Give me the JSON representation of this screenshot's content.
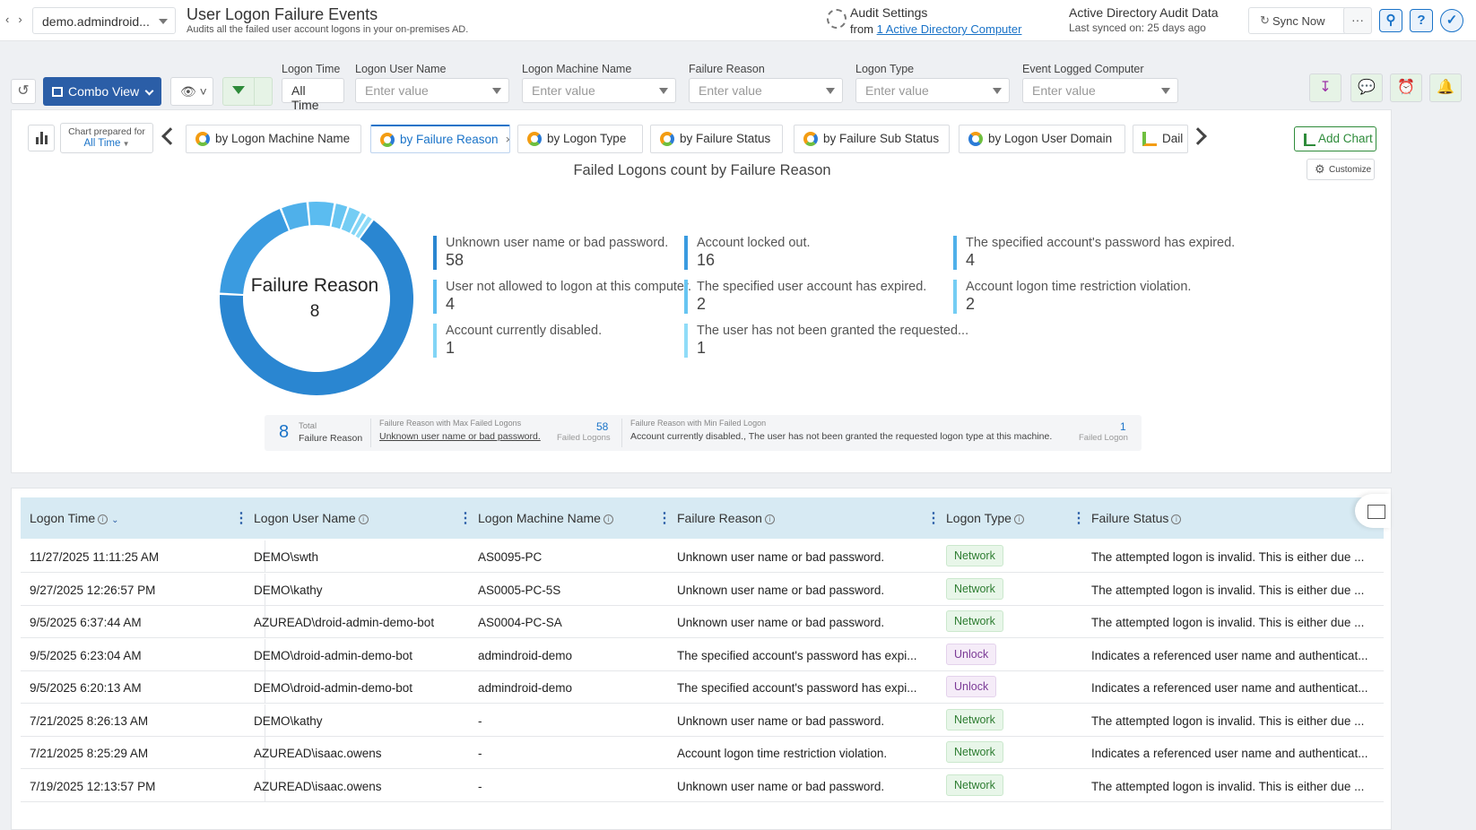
{
  "topbar": {
    "tenant": "demo.admindroid...",
    "title": "User Logon Failure Events",
    "subtitle": "Audits all the failed user account logons in your on-premises AD.",
    "audit_settings": "Audit Settings",
    "audit_from": "from",
    "audit_link": "1 Active Directory Computer",
    "ad_title": "Active Directory Audit Data",
    "last_synced_label": "Last synced on:",
    "last_synced_value": "25 days ago",
    "sync_now": "Sync Now",
    "more": "···"
  },
  "filters": {
    "combo_view": "Combo View",
    "logon_time_label": "Logon Time",
    "logon_time_value": "All Time",
    "user_label": "Logon User Name",
    "machine_label": "Logon Machine Name",
    "reason_label": "Failure Reason",
    "type_label": "Logon Type",
    "computer_label": "Event Logged Computer",
    "placeholder": "Enter value"
  },
  "chart_panel": {
    "prepared_for": "Chart prepared for",
    "prepared_value": "All Time",
    "tabs": [
      "by Logon Machine Name",
      "by Failure Reason",
      "by Logon Type",
      "by Failure Status",
      "by Failure Sub Status",
      "by Logon User Domain",
      "Dail"
    ],
    "add_chart": "Add Chart",
    "customize": "Customize",
    "center_label": "Failure Reason",
    "center_value": "8"
  },
  "chart_data": {
    "type": "pie",
    "title": "Failed Logons count by Failure Reason",
    "categories": [
      "Unknown user name or bad password.",
      "Account locked out.",
      "The specified account's password has expired.",
      "User not allowed to logon at this computer.",
      "The specified user account has expired.",
      "Account logon time restriction violation.",
      "Account currently disabled.",
      "The user has not been granted the requested..."
    ],
    "values": [
      58,
      16,
      4,
      4,
      2,
      2,
      1,
      1
    ],
    "colors": [
      "#2a86d1",
      "#3a9be0",
      "#4fb0ea",
      "#5bbcf0",
      "#67c5f2",
      "#74cdf4",
      "#82d5f6",
      "#90dcf8"
    ]
  },
  "summary": {
    "total_num": "8",
    "total_label": "Total",
    "total_sub": "Failure Reason",
    "max_head": "Failure Reason with Max Failed Logons",
    "max_link": "Unknown user name or bad password.",
    "max_num": "58",
    "max_sub": "Failed Logons",
    "min_head": "Failure Reason with Min Failed Logon",
    "min_text": "Account currently disabled., The user has not been granted the requested logon type at this machine.",
    "min_num": "1",
    "min_sub": "Failed Logon"
  },
  "table": {
    "headers": [
      "Logon Time",
      "Logon User Name",
      "Logon Machine Name",
      "Failure Reason",
      "Logon Type",
      "Failure Status"
    ],
    "rows": [
      [
        "11/27/2025 11:11:25 AM",
        "DEMO\\swth",
        "AS0095-PC",
        "Unknown user name or bad password.",
        "Network",
        "The attempted logon is invalid. This is either due ..."
      ],
      [
        "9/27/2025 12:26:57 PM",
        "DEMO\\kathy",
        "AS0005-PC-5S",
        "Unknown user name or bad password.",
        "Network",
        "The attempted logon is invalid. This is either due ..."
      ],
      [
        "9/5/2025 6:37:44 AM",
        "AZUREAD\\droid-admin-demo-bot",
        "AS0004-PC-SA",
        "Unknown user name or bad password.",
        "Network",
        "The attempted logon is invalid. This is either due ..."
      ],
      [
        "9/5/2025 6:23:04 AM",
        "DEMO\\droid-admin-demo-bot",
        "admindroid-demo",
        "The specified account's password has expi...",
        "Unlock",
        "Indicates a referenced user name and authenticat..."
      ],
      [
        "9/5/2025 6:20:13 AM",
        "DEMO\\droid-admin-demo-bot",
        "admindroid-demo",
        "The specified account's password has expi...",
        "Unlock",
        "Indicates a referenced user name and authenticat..."
      ],
      [
        "7/21/2025 8:26:13 AM",
        "DEMO\\kathy",
        "-",
        "Unknown user name or bad password.",
        "Network",
        "The attempted logon is invalid. This is either due ..."
      ],
      [
        "7/21/2025 8:25:29 AM",
        "AZUREAD\\isaac.owens",
        "-",
        "Account logon time restriction violation.",
        "Network",
        "Indicates a referenced user name and authenticat..."
      ],
      [
        "7/19/2025 12:13:57 PM",
        "AZUREAD\\isaac.owens",
        "-",
        "Unknown user name or bad password.",
        "Network",
        "The attempted logon is invalid. This is either due ..."
      ]
    ]
  }
}
